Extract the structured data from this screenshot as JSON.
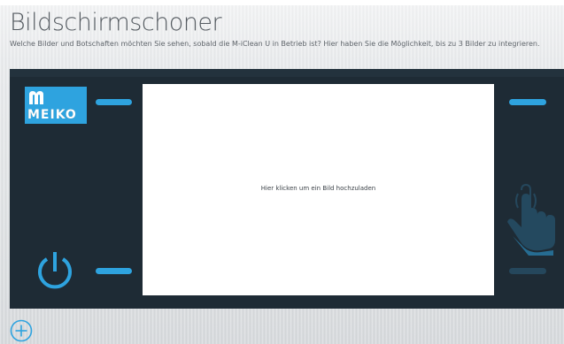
{
  "header": {
    "title": "Bildschirmschoner",
    "subtitle": "Welche Bilder und Botschaften möchten Sie sehen, sobald die M-iClean U in Betrieb ist? Hier haben Sie die Möglichkeit, bis zu 3 Bilder zu integrieren."
  },
  "panel": {
    "logo": {
      "text": "MEIKO"
    },
    "upload": {
      "prompt": "Hier klicken um ein Bild hochzuladen"
    },
    "icons": {
      "power": "power-icon",
      "hand": "hand-touch-icon",
      "add": "add-circle-icon",
      "logo_mark": "meiko-m-icon"
    }
  },
  "colors": {
    "accent": "#2ea3df",
    "panel": "#1e2b35",
    "upload_background": "#ffffff",
    "accent_dim": "#25475c"
  }
}
